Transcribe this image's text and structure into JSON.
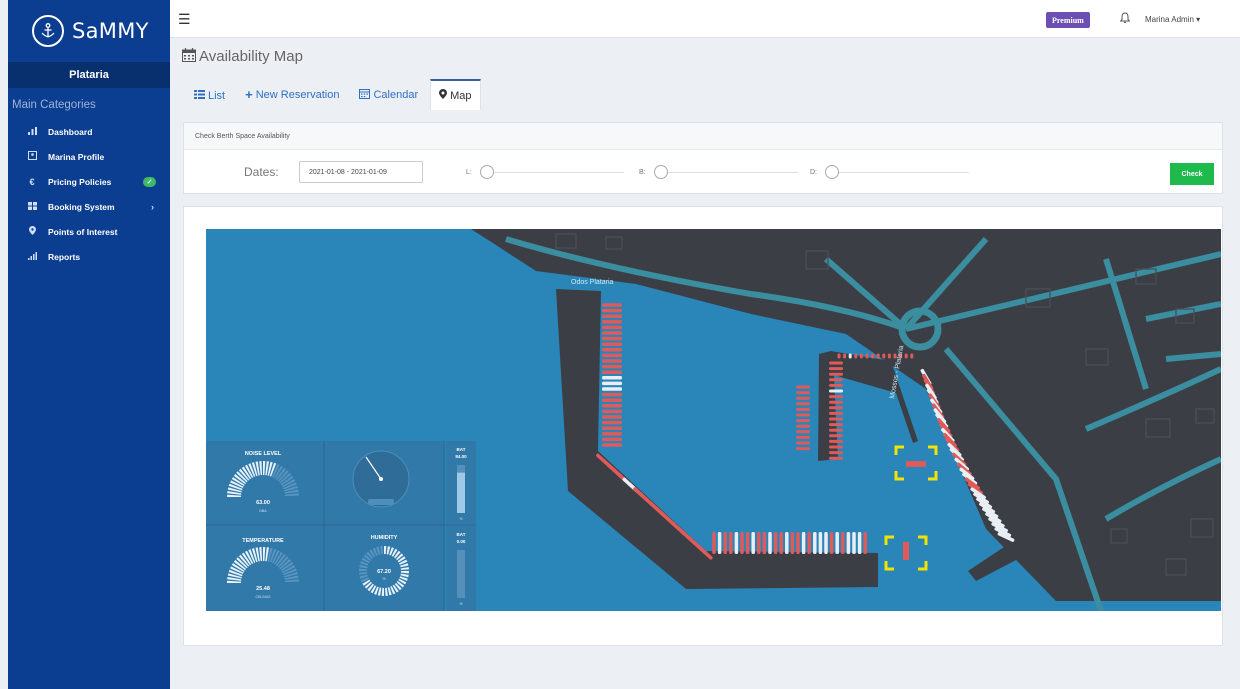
{
  "app": {
    "logo_text": "SaMMY",
    "marina_name": "Plataria",
    "categories_title": "Main Categories"
  },
  "sidebar": {
    "items": [
      {
        "label": "Dashboard",
        "icon": "bar-chart-icon"
      },
      {
        "label": "Marina Profile",
        "icon": "profile-icon"
      },
      {
        "label": "Pricing Policies",
        "icon": "euro-icon",
        "badge": true
      },
      {
        "label": "Booking System",
        "icon": "grid-icon",
        "chevron": true
      },
      {
        "label": "Points of Interest",
        "icon": "map-pin-icon"
      },
      {
        "label": "Reports",
        "icon": "reports-icon"
      }
    ]
  },
  "topbar": {
    "premium_label": "Premium",
    "user_label": "Marina Admin"
  },
  "page": {
    "title": "Availability Map"
  },
  "tabs": [
    {
      "label": "List",
      "icon": "list-icon",
      "active": false
    },
    {
      "label": "New Reservation",
      "icon": "plus-icon",
      "active": false
    },
    {
      "label": "Calendar",
      "icon": "calendar-icon",
      "active": false
    },
    {
      "label": "Map",
      "icon": "map-marker-icon",
      "active": true
    }
  ],
  "availability": {
    "header": "Check Berth Space Availability",
    "dates_label": "Dates:",
    "dates_value": "2021-01-08 - 2021-01-09",
    "slider_l_label": "L:",
    "slider_b_label": "B:",
    "slider_d_label": "D:",
    "check_label": "Check"
  },
  "map": {
    "street_label_1": "Odos Plataria",
    "street_label_2": "Mossos - Plataria"
  },
  "sensors": {
    "noise": {
      "title": "NOISE LEVEL",
      "value": "63.00",
      "unit": "DBA",
      "fraction": 0.63
    },
    "temperature": {
      "title": "TEMPERATURE",
      "value": "25.48",
      "unit": "CELSIUS",
      "fraction": 0.55
    },
    "humidity": {
      "title": "HUMIDITY",
      "value": "67.20",
      "unit": "%",
      "fraction": 0.672
    },
    "bat1": {
      "title": "BAT",
      "value": "84.00",
      "unit": "%",
      "fraction": 0.84
    },
    "bat2": {
      "title": "BAT",
      "value": "0.00",
      "unit": "%",
      "fraction": 0.0
    }
  },
  "colors": {
    "sidebar_bg": "#0b3d91",
    "water": "#2a86b8",
    "land": "#3b3f45",
    "road": "#3b8da0",
    "berth_occupied": "#e05a5a",
    "berth_free": "#e9eef5",
    "check_button": "#1fba4c",
    "premium_badge": "#6c4fb3",
    "highlight_marker": "#f2e200"
  }
}
